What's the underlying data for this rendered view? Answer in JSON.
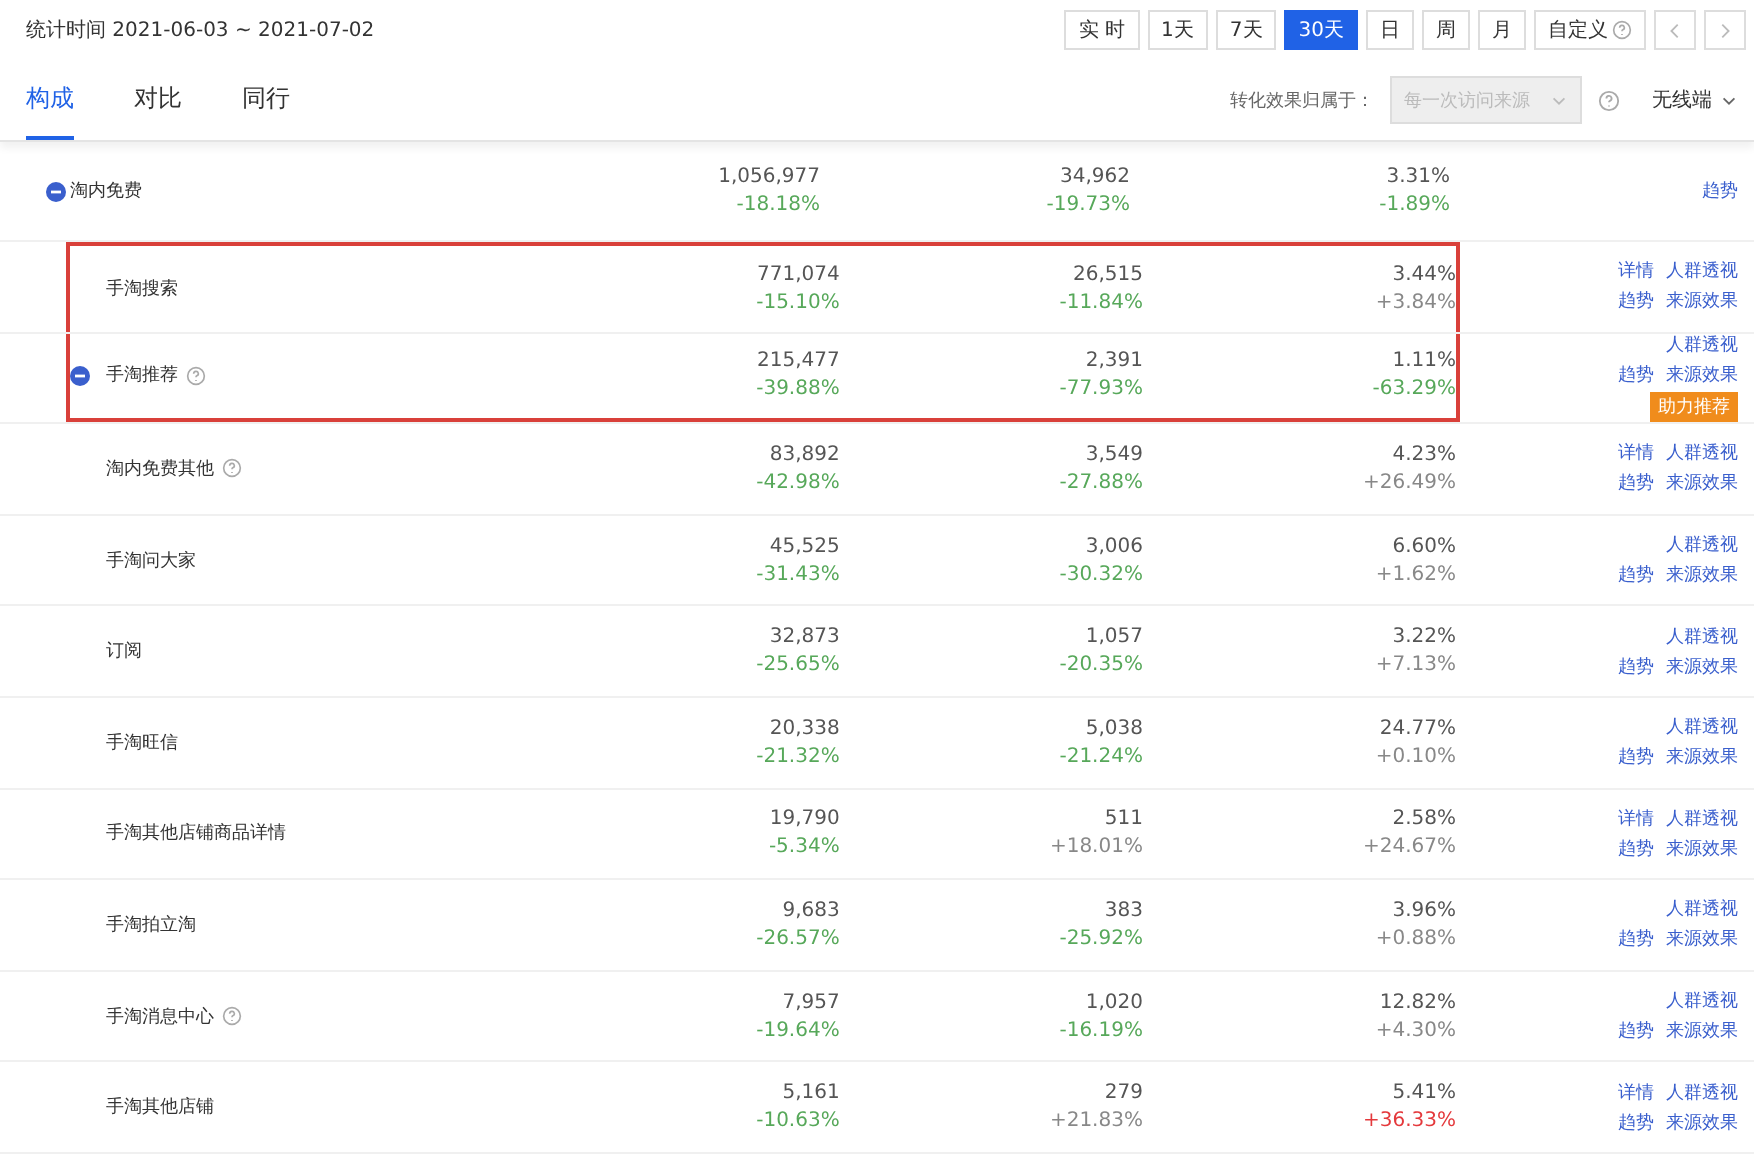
{
  "period": {
    "label": "统计时间 2021-06-03 ~ 2021-07-02"
  },
  "range_buttons": [
    {
      "label": "实 时",
      "selected": false
    },
    {
      "label": "1天",
      "selected": false
    },
    {
      "label": "7天",
      "selected": false
    },
    {
      "label": "30天",
      "selected": true
    },
    {
      "label": "日",
      "selected": false
    },
    {
      "label": "周",
      "selected": false
    },
    {
      "label": "月",
      "selected": false
    },
    {
      "label": "自定义",
      "selected": false,
      "help": true
    }
  ],
  "tabs": [
    {
      "label": "构成",
      "selected": true
    },
    {
      "label": "对比",
      "selected": false
    },
    {
      "label": "同行",
      "selected": false
    }
  ],
  "attribution": {
    "label": "转化效果归属于：",
    "value": "每一次访问来源",
    "disabled": true
  },
  "device": {
    "value": "无线端"
  },
  "rows": [
    {
      "name": "淘内免费",
      "expanded": true,
      "indent": false,
      "help": false,
      "highlighted": false,
      "cells": [
        {
          "value": "1,056,977",
          "change": "-18.18%",
          "color": "#57a85a"
        },
        {
          "value": "34,962",
          "change": "-19.73%",
          "color": "#57a85a"
        },
        {
          "value": "3.31%",
          "change": "-1.89%",
          "color": "#57a85a"
        }
      ],
      "actions": [
        [
          "趋势"
        ]
      ]
    },
    {
      "name": "手淘搜索",
      "indent": true,
      "help": false,
      "highlighted": true,
      "cells": [
        {
          "value": "771,074",
          "change": "-15.10%",
          "color": "#57a85a"
        },
        {
          "value": "26,515",
          "change": "-11.84%",
          "color": "#57a85a"
        },
        {
          "value": "3.44%",
          "change": "+3.84%",
          "color": "#888888"
        }
      ],
      "actions": [
        [
          "详情",
          "人群透视"
        ],
        [
          "趋势",
          "来源效果"
        ]
      ]
    },
    {
      "name": "手淘推荐",
      "expanded": true,
      "indent": true,
      "help": true,
      "highlighted": true,
      "cells": [
        {
          "value": "215,477",
          "change": "-39.88%",
          "color": "#57a85a"
        },
        {
          "value": "2,391",
          "change": "-77.93%",
          "color": "#57a85a"
        },
        {
          "value": "1.11%",
          "change": "-63.29%",
          "color": "#57a85a"
        }
      ],
      "actions": [
        [
          "人群透视"
        ],
        [
          "趋势",
          "来源效果"
        ]
      ],
      "badge": "助力推荐"
    },
    {
      "name": "淘内免费其他",
      "indent": true,
      "help": true,
      "highlighted": false,
      "cells": [
        {
          "value": "83,892",
          "change": "-42.98%",
          "color": "#57a85a"
        },
        {
          "value": "3,549",
          "change": "-27.88%",
          "color": "#57a85a"
        },
        {
          "value": "4.23%",
          "change": "+26.49%",
          "color": "#888888"
        }
      ],
      "actions": [
        [
          "详情",
          "人群透视"
        ],
        [
          "趋势",
          "来源效果"
        ]
      ]
    },
    {
      "name": "手淘问大家",
      "indent": true,
      "help": false,
      "highlighted": false,
      "cells": [
        {
          "value": "45,525",
          "change": "-31.43%",
          "color": "#57a85a"
        },
        {
          "value": "3,006",
          "change": "-30.32%",
          "color": "#57a85a"
        },
        {
          "value": "6.60%",
          "change": "+1.62%",
          "color": "#888888"
        }
      ],
      "actions": [
        [
          "人群透视"
        ],
        [
          "趋势",
          "来源效果"
        ]
      ]
    },
    {
      "name": "订阅",
      "indent": true,
      "help": false,
      "highlighted": false,
      "cells": [
        {
          "value": "32,873",
          "change": "-25.65%",
          "color": "#57a85a"
        },
        {
          "value": "1,057",
          "change": "-20.35%",
          "color": "#57a85a"
        },
        {
          "value": "3.22%",
          "change": "+7.13%",
          "color": "#888888"
        }
      ],
      "actions": [
        [
          "人群透视"
        ],
        [
          "趋势",
          "来源效果"
        ]
      ]
    },
    {
      "name": "手淘旺信",
      "indent": true,
      "help": false,
      "highlighted": false,
      "cells": [
        {
          "value": "20,338",
          "change": "-21.32%",
          "color": "#57a85a"
        },
        {
          "value": "5,038",
          "change": "-21.24%",
          "color": "#57a85a"
        },
        {
          "value": "24.77%",
          "change": "+0.10%",
          "color": "#888888"
        }
      ],
      "actions": [
        [
          "人群透视"
        ],
        [
          "趋势",
          "来源效果"
        ]
      ]
    },
    {
      "name": "手淘其他店铺商品详情",
      "indent": true,
      "help": false,
      "highlighted": false,
      "cells": [
        {
          "value": "19,790",
          "change": "-5.34%",
          "color": "#57a85a"
        },
        {
          "value": "511",
          "change": "+18.01%",
          "color": "#888888"
        },
        {
          "value": "2.58%",
          "change": "+24.67%",
          "color": "#888888"
        }
      ],
      "actions": [
        [
          "详情",
          "人群透视"
        ],
        [
          "趋势",
          "来源效果"
        ]
      ]
    },
    {
      "name": "手淘拍立淘",
      "indent": true,
      "help": false,
      "highlighted": false,
      "cells": [
        {
          "value": "9,683",
          "change": "-26.57%",
          "color": "#57a85a"
        },
        {
          "value": "383",
          "change": "-25.92%",
          "color": "#57a85a"
        },
        {
          "value": "3.96%",
          "change": "+0.88%",
          "color": "#888888"
        }
      ],
      "actions": [
        [
          "人群透视"
        ],
        [
          "趋势",
          "来源效果"
        ]
      ]
    },
    {
      "name": "手淘消息中心",
      "indent": true,
      "help": true,
      "highlighted": false,
      "cells": [
        {
          "value": "7,957",
          "change": "-19.64%",
          "color": "#57a85a"
        },
        {
          "value": "1,020",
          "change": "-16.19%",
          "color": "#57a85a"
        },
        {
          "value": "12.82%",
          "change": "+4.30%",
          "color": "#888888"
        }
      ],
      "actions": [
        [
          "人群透视"
        ],
        [
          "趋势",
          "来源效果"
        ]
      ]
    },
    {
      "name": "手淘其他店铺",
      "indent": true,
      "help": false,
      "highlighted": false,
      "cells": [
        {
          "value": "5,161",
          "change": "-10.63%",
          "color": "#57a85a"
        },
        {
          "value": "279",
          "change": "+21.83%",
          "color": "#888888"
        },
        {
          "value": "5.41%",
          "change": "+36.33%",
          "color": "#e4393c"
        }
      ],
      "actions": [
        [
          "详情",
          "人群透视"
        ],
        [
          "趋势",
          "来源效果"
        ]
      ]
    }
  ]
}
